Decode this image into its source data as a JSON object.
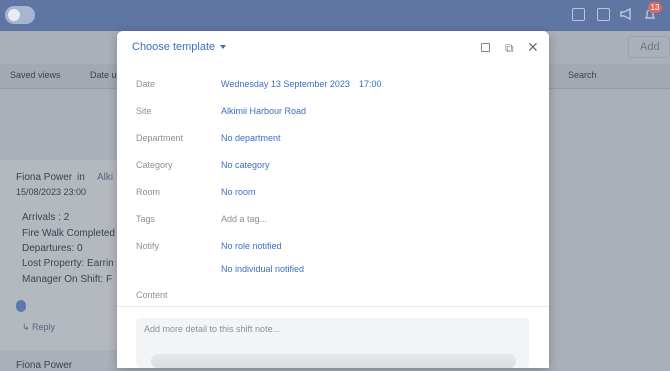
{
  "topbar": {
    "badge_count": "13"
  },
  "background": {
    "saved_views": "Saved views",
    "date_filter": "Date u",
    "search": "Search",
    "add": "Add",
    "card": {
      "author": "Fiona Power",
      "in": "in",
      "site_prefix": "Alki",
      "timestamp": "15/08/2023 23:00",
      "fields": [
        {
          "label": "Arrivals :",
          "value": "2"
        },
        {
          "label": "Fire Walk Completed",
          "value": ""
        },
        {
          "label": "Departures:",
          "value": "0"
        },
        {
          "label": "Lost Property:",
          "value": "Earrin"
        },
        {
          "label": "Manager On Shift:",
          "value": "F"
        }
      ],
      "reply": "Reply",
      "next_author": "Fiona Power"
    }
  },
  "modal": {
    "template_label": "Choose template",
    "rows": {
      "date_label": "Date",
      "date_value": "Wednesday 13 September 2023",
      "time_value": "17:00",
      "site_label": "Site",
      "site_value": "Alkimii Harbour Road",
      "department_label": "Department",
      "department_value": "No department",
      "category_label": "Category",
      "category_value": "No category",
      "room_label": "Room",
      "room_value": "No room",
      "tags_label": "Tags",
      "tags_placeholder": "Add a tag...",
      "notify_label": "Notify",
      "notify_role": "No role notified",
      "notify_individual": "No individual notified",
      "content_label": "Content"
    },
    "content_placeholder": "Add more detail to this shift note...",
    "accent_color": "#3d6ec0"
  }
}
